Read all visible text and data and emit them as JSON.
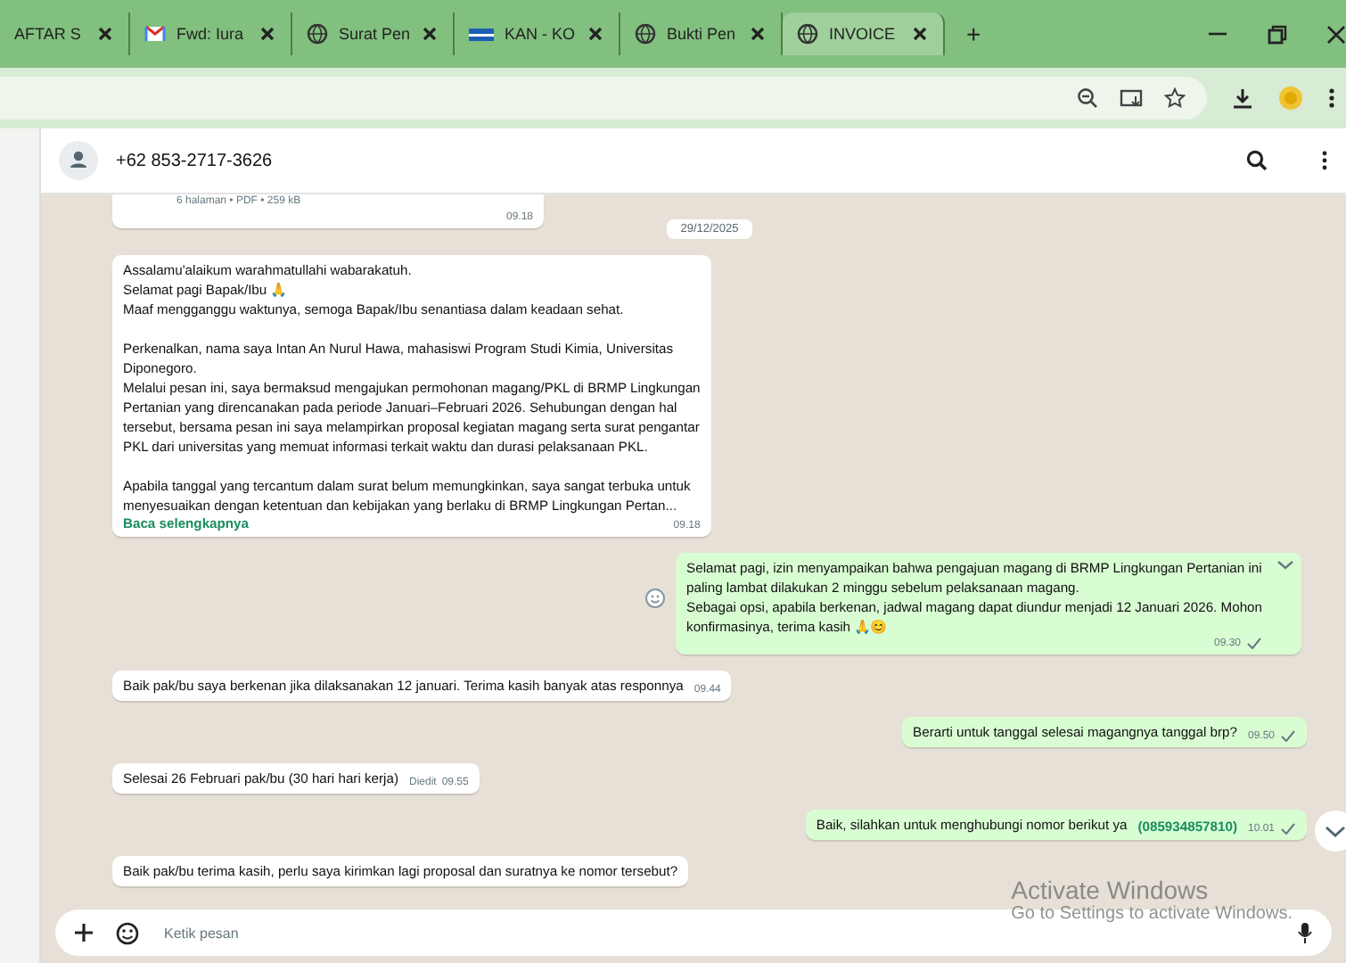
{
  "browser": {
    "tabs": [
      {
        "title": "AFTAR S",
        "kind": "plain",
        "selected": false
      },
      {
        "title": "Fwd: Iura",
        "kind": "mail",
        "selected": false
      },
      {
        "title": "Surat Pen",
        "kind": "site",
        "selected": false
      },
      {
        "title": "KAN - KO",
        "kind": "flag",
        "selected": false
      },
      {
        "title": "Bukti Pen",
        "kind": "site",
        "selected": false
      },
      {
        "title": "INVOICE",
        "kind": "site",
        "selected": true
      }
    ],
    "new_tab": "+"
  },
  "chat": {
    "contact": "+62 853-2717-3626",
    "messages": [
      {
        "kind": "document",
        "meta": "6 halaman • PDF • 259 kB",
        "time": "09.18"
      },
      {
        "kind": "date",
        "text": "29/12/2025"
      },
      {
        "kind": "incoming",
        "text": "Assalamu'alaikum warahmatullahi wabarakatuh.\nSelamat pagi Bapak/Ibu 🙏\nMaaf mengganggu waktunya, semoga Bapak/Ibu senantiasa dalam keadaan sehat.\n\nPerkenalkan, nama saya Intan An Nurul Hawa, mahasiswi Program Studi Kimia, Universitas\nDiponegoro.\nMelalui pesan ini, saya bermaksud mengajukan permohonan magang/PKL di BRMP Lingkungan\nPertanian yang direncanakan pada periode Januari–Februari 2026. Sehubungan dengan hal\ntersebut, bersama pesan ini saya melampirkan proposal kegiatan magang serta surat pengantar\nPKL dari universitas yang memuat informasi terkait waktu dan durasi pelaksanaan PKL.\n\nApabila tanggal yang tercantum dalam surat belum memungkinkan, saya sangat terbuka untuk\nmenyesuaikan dengan ketentuan dan kebijakan yang berlaku di BRMP Lingkungan Pertan...",
        "read_more": "Baca selengkapnya",
        "time": "09.18"
      },
      {
        "kind": "outgoing",
        "text": "Selamat pagi, izin menyampaikan bahwa pengajuan magang di BRMP Lingkungan Pertanian ini\npaling lambat dilakukan 2 minggu sebelum pelaksanaan magang.\nSebagai opsi, apabila berkenan, jadwal magang dapat diundur menjadi 12 Januari 2026. Mohon\nkonfirmasinya, terima kasih 🙏😊",
        "time": "09.30",
        "menu": true
      },
      {
        "kind": "incoming",
        "text": "Baik pak/bu saya berkenan jika dilaksanakan 12 januari. Terima kasih banyak atas responnya",
        "time": "09.44"
      },
      {
        "kind": "outgoing",
        "text": "Berarti untuk tanggal selesai magangnya tanggal brp?",
        "time": "09.50"
      },
      {
        "kind": "incoming",
        "text": "Selesai 26 Februari pak/bu (30 hari hari kerja)",
        "edited": "Diedit",
        "time": "09.55"
      },
      {
        "kind": "outgoing",
        "text": "Baik, silahkan untuk menghubungi nomor berikut ya",
        "link": "(085934857810)",
        "time": "10.01"
      },
      {
        "kind": "incoming",
        "text": "Baik pak/bu terima kasih, perlu saya kirimkan lagi proposal dan suratnya ke nomor tersebut?"
      }
    ],
    "input": {
      "placeholder": "Ketik pesan"
    }
  },
  "os_notice": {
    "title": "Activate Windows",
    "text": "Go to Settings to activate Windows."
  }
}
